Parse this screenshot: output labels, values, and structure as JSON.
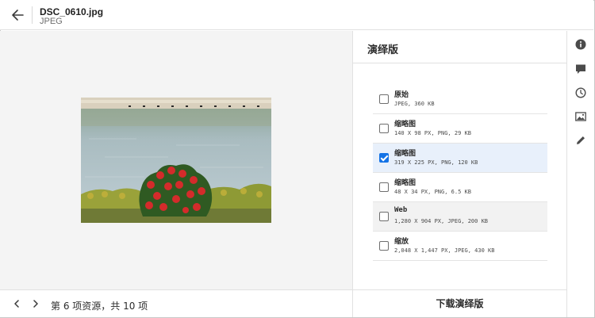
{
  "header": {
    "file_name": "DSC_0610.jpg",
    "file_type": "JPEG",
    "back_icon": "arrow-left-icon"
  },
  "footer": {
    "asset_count": "第 6 项资源，共 10 项",
    "prev_icon": "chevron-left-icon",
    "next_icon": "chevron-right-icon"
  },
  "panel": {
    "title": "演绎版",
    "renditions": [
      {
        "name": "原始",
        "detail": "JPEG, 360 KB",
        "checked": false
      },
      {
        "name": "缩略图",
        "detail": "140 X 98 PX, PNG, 29 KB",
        "checked": false
      },
      {
        "name": "缩略图",
        "detail": "319 X 225 PX, PNG, 120 KB",
        "checked": true
      },
      {
        "name": "缩略图",
        "detail": "48 X 34 PX, PNG, 6.5 KB",
        "checked": false
      },
      {
        "name": "Web",
        "detail": "1,280 X 904 PX, JPEG, 200 KB",
        "checked": false
      },
      {
        "name": "缩放",
        "detail": "2,048 X 1,447 PX, JPEG, 430 KB",
        "checked": false
      }
    ],
    "download_label": "下载演绎版"
  },
  "rail": {
    "icons": [
      "info-icon",
      "comment-icon",
      "history-icon",
      "image-icon",
      "edit-icon"
    ]
  },
  "colors": {
    "accent": "#1473e6",
    "selected_row": "#e8f0fb",
    "preview_bg": "#f4f4f4"
  }
}
